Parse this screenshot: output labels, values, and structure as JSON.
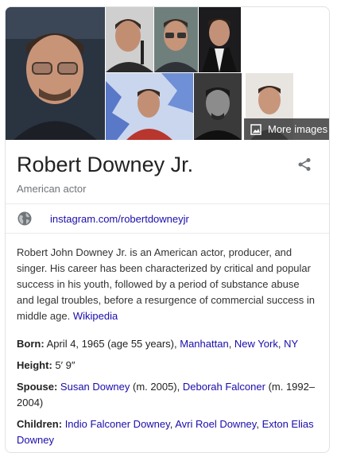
{
  "images": {
    "more_label": "More images",
    "photos": [
      {
        "icon": "portrait-photo-main"
      },
      {
        "icon": "portrait-photo-2"
      },
      {
        "icon": "portrait-photo-3"
      },
      {
        "icon": "portrait-photo-4"
      },
      {
        "icon": "portrait-photo-5"
      },
      {
        "icon": "portrait-photo-6"
      },
      {
        "icon": "portrait-photo-7"
      }
    ]
  },
  "header": {
    "title": "Robert Downey Jr.",
    "subtitle": "American actor",
    "share_icon": "share-icon"
  },
  "link": {
    "icon": "globe-icon",
    "text": "instagram.com/robertdowneyjr"
  },
  "description": {
    "text": "Robert John Downey Jr. is an American actor, producer, and singer. His career has been characterized by critical and popular success in his youth, followed by a period of substance abuse and legal troubles, before a resurgence of commercial success in middle age.",
    "source_link": "Wikipedia"
  },
  "facts": {
    "born": {
      "label": "Born:",
      "text": "April 4, 1965 (age 55 years),",
      "links": [
        "Manhattan",
        "New York",
        "NY"
      ]
    },
    "height": {
      "label": "Height:",
      "text": "5′ 9″"
    },
    "spouse": {
      "label": "Spouse:",
      "link1": "Susan Downey",
      "text1": "(m. 2005),",
      "link2": "Deborah Falconer",
      "text2": "(m. 1992–2004)"
    },
    "children": {
      "label": "Children:",
      "links": [
        "Indio Falconer Downey",
        "Avri Roel Downey",
        "Exton Elias Downey"
      ]
    }
  },
  "colors": {
    "link": "#1a0dab",
    "muted": "#70757a",
    "border": "#dfe1e5"
  }
}
